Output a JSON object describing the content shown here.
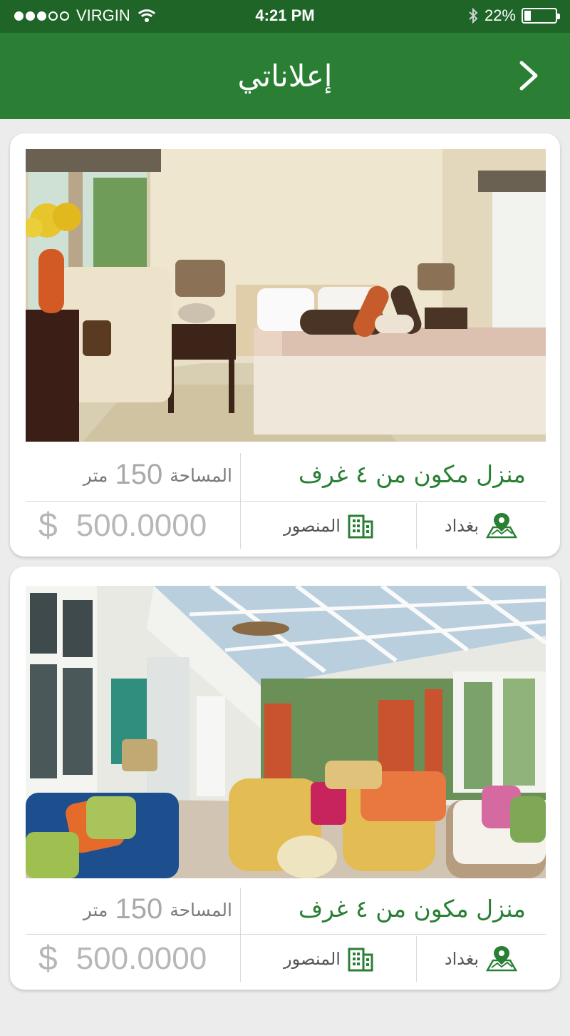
{
  "status_bar": {
    "carrier": "VIRGIN",
    "time": "4:21 PM",
    "battery_text": "22%",
    "battery_level": 0.22,
    "signal_bars_filled": 3,
    "signal_bars_total": 5,
    "icons": [
      "signal-dots-icon",
      "wifi-icon",
      "bluetooth-icon",
      "battery-icon"
    ]
  },
  "header": {
    "title": "إعلاناتي",
    "back_icon": "chevron-right-icon"
  },
  "colors": {
    "primary": "#2a7f35",
    "status_bar": "#1e6527",
    "background": "#ececec",
    "price": "#b7b7b7"
  },
  "listings": [
    {
      "image": "bedroom-photo",
      "title": "منزل مكون من ٤ غرف",
      "area_label": "المساحة",
      "area_value": "150",
      "area_unit": "متر",
      "price": "500.0000",
      "currency": "$",
      "district": "المنصور",
      "district_icon": "building-icon",
      "city": "بغداد",
      "city_icon": "map-pin-icon"
    },
    {
      "image": "sunroom-photo",
      "title": "منزل مكون من ٤ غرف",
      "area_label": "المساحة",
      "area_value": "150",
      "area_unit": "متر",
      "price": "500.0000",
      "currency": "$",
      "district": "المنصور",
      "district_icon": "building-icon",
      "city": "بغداد",
      "city_icon": "map-pin-icon"
    }
  ]
}
